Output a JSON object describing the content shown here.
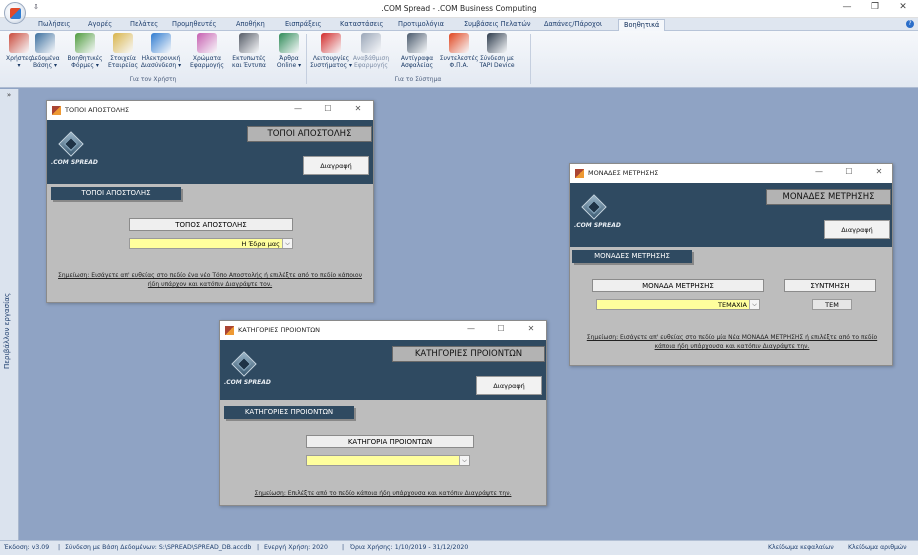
{
  "app": {
    "quick_access": "⇩",
    "title": ".COM Spread - .COM Business Computing",
    "win_min": "—",
    "win_restore": "❐",
    "win_close": "✕"
  },
  "tabs": [
    "Πωλήσεις",
    "Αγορές",
    "Πελάτες",
    "Προμηθευτές",
    "Αποθήκη",
    "Εισπράξεις",
    "Καταστάσεις",
    "Προτιμολόγια",
    "Συμβάσεις Πελατών",
    "Δαπάνες/Πάροχοι",
    "Βοηθητικά"
  ],
  "ribbon": {
    "groups": [
      {
        "label": "Για τον Χρήστη",
        "buttons": [
          {
            "l1": "Χρήστες",
            "l2": "▾",
            "icon": "users-calendar-icon",
            "color": "#c94a3b"
          },
          {
            "l1": "Δεδομένα",
            "l2": "Βάσης ▾",
            "icon": "database-icon",
            "color": "#3c6f9e"
          },
          {
            "l1": "Βοηθητικές",
            "l2": "Φόρμες ▾",
            "icon": "forms-icon",
            "color": "#4f9b3d"
          },
          {
            "l1": "Στοιχεία",
            "l2": "Εταιρείας",
            "icon": "company-icon",
            "color": "#d8b44a"
          },
          {
            "l1": "Ηλεκτρονική",
            "l2": "Διασύνδεση ▾",
            "icon": "globe-icon",
            "color": "#2f7bd0"
          },
          {
            "l1": "Χρώματα",
            "l2": "Εφαρμογής",
            "icon": "palette-icon",
            "color": "#c65fb0"
          },
          {
            "l1": "Εκτυπωτές",
            "l2": "και Έντυπα",
            "icon": "printer-icon",
            "color": "#555b66"
          },
          {
            "l1": "Άρθρα",
            "l2": "Online ▾",
            "icon": "pen-icon",
            "color": "#2e8a57"
          }
        ]
      },
      {
        "label": "Για το Σύστημα",
        "buttons": [
          {
            "l1": "Λειτουργίες",
            "l2": "Συστήματος ▾",
            "icon": "gear-icon",
            "color": "#d22b2b",
            "dim": false
          },
          {
            "l1": "Αναβάθμιση",
            "l2": "Εφαρμογής",
            "icon": "update-icon",
            "color": "#9aa6b8",
            "dim": true
          },
          {
            "l1": "Αντίγραφα",
            "l2": "Ασφαλείας",
            "icon": "backup-icon",
            "color": "#4a5a6c",
            "dim": false
          },
          {
            "l1": "Συντελεστές",
            "l2": "Φ.Π.Α.",
            "icon": "percent-icon",
            "color": "#e0451f",
            "dim": false
          },
          {
            "l1": "Σύνδεση με",
            "l2": "TAPI Device",
            "icon": "phone-icon",
            "color": "#2d3b4c",
            "dim": false
          }
        ]
      }
    ]
  },
  "sidebar": {
    "toggle": "»",
    "label": "Περιβάλλον εργασίας"
  },
  "logo_text": ".COM SPREAD",
  "windows": {
    "shipping": {
      "title": "ΤΟΠΟΙ ΑΠΟΣΤΟΛΗΣ",
      "header": "ΤΟΠΟΙ ΑΠΟΣΤΟΛΗΣ",
      "delete": "Διαγραφή",
      "section": "ΤΟΠΟΙ ΑΠΟΣΤΟΛΗΣ",
      "field_label": "ΤΟΠΟΣ ΑΠΟΣΤΟΛΗΣ",
      "field_value": "Η Έδρα μας",
      "note": "Σημείωση: Εισάγετε απ' ευθείας στο πεδίο ένα νέο Τόπο Αποστολής ή επιλέξτε από το πεδίο κάποιον ήδη υπάρχον και κατόπιν Διαγράψτε τον."
    },
    "categories": {
      "title": "ΚΑΤΗΓΟΡΙΕΣ ΠΡΟΙΟΝΤΩΝ",
      "header": "ΚΑΤΗΓΟΡΙΕΣ ΠΡΟΙΟΝΤΩΝ",
      "delete": "Διαγραφή",
      "section": "ΚΑΤΗΓΟΡΙΕΣ ΠΡΟΙΟΝΤΩΝ",
      "field_label": "ΚΑΤΗΓΟΡΙΑ ΠΡΟΙΟΝΤΩΝ",
      "field_value": "",
      "note": "Σημείωση: Επιλέξτε από το πεδίο κάποια ήδη υπάρχουσα και κατόπιν Διαγράψτε την."
    },
    "units": {
      "title": "ΜΟΝΑΔΕΣ ΜΕΤΡΗΣΗΣ",
      "header": "ΜΟΝΑΔΕΣ ΜΕΤΡΗΣΗΣ",
      "delete": "Διαγραφή",
      "section": "ΜΟΝΑΔΕΣ ΜΕΤΡΗΣΗΣ",
      "field_label": "ΜΟΝΑΔΑ ΜΕΤΡΗΣΗΣ",
      "field_value": "ΤΕΜΑΧΙΑ",
      "abbr_label": "ΣΥΝΤΜΗΣΗ",
      "abbr_value": "ΤΕΜ",
      "note": "Σημείωση: Εισάγετε απ' ευθείας στο πεδίο μία Νέα ΜΟΝΑΔΑ ΜΕΤΡΗΣΗΣ ή επιλέξτε από το πεδίο κάποια ήδη υπάρχουσα και κατόπιν Διαγράψτε την."
    }
  },
  "status": {
    "version": "Έκδοση: v3.09",
    "sep": "|",
    "db": "Σύνδεση με Βάση Δεδομένων: S:\\SPREAD\\SPREAD_DB.accdb",
    "year": "Ενεργή Χρήση: 2020",
    "range": "Όρια Χρήσης: 1/10/2019 - 31/12/2020",
    "caps": "Κλείδωμα κεφαλαίων",
    "num": "Κλείδωμα αριθμών"
  }
}
